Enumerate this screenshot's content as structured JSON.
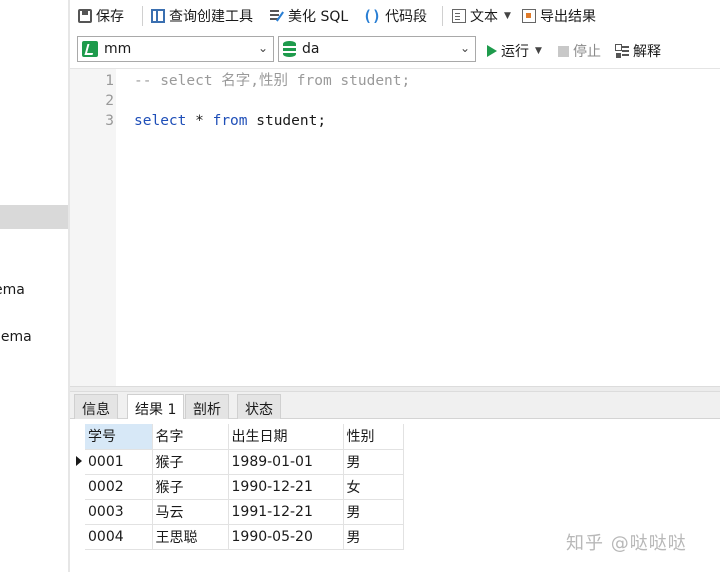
{
  "sidebar": {
    "items": [
      "ema",
      "nema"
    ]
  },
  "toolbar": {
    "save": "保存",
    "query_builder": "查询创建工具",
    "beautify": "美化 SQL",
    "snippet_icon": "()",
    "snippet": "代码段",
    "text": "文本",
    "export": "导出结果"
  },
  "connection": {
    "connection_value": "mm",
    "database_value": "da",
    "run": "运行",
    "stop": "停止",
    "explain": "解释"
  },
  "editor": {
    "lines": [
      {
        "number": "1",
        "tokens": [
          "-- select 名字,性别 from student;"
        ]
      },
      {
        "number": "2",
        "tokens": []
      },
      {
        "number": "3",
        "tokens": [
          "select",
          " * ",
          "from",
          " student;"
        ]
      }
    ]
  },
  "result_tabs": [
    "信息",
    "结果 1",
    "剖析",
    "状态"
  ],
  "result": {
    "columns": [
      "学号",
      "名字",
      "出生日期",
      "性别"
    ],
    "rows": [
      [
        "0001",
        "猴子",
        "1989-01-01",
        "男"
      ],
      [
        "0002",
        "猴子",
        "1990-12-21",
        "女"
      ],
      [
        "0003",
        "马云",
        "1991-12-21",
        "男"
      ],
      [
        "0004",
        "王思聪",
        "1990-05-20",
        "男"
      ]
    ]
  },
  "watermark": "知乎 @哒哒哒",
  "colors": {
    "keyword": "#1f4fb8",
    "comment": "#9a9a9a",
    "run_green": "#1e9b4c",
    "selected_header": "#d7e8f7"
  }
}
